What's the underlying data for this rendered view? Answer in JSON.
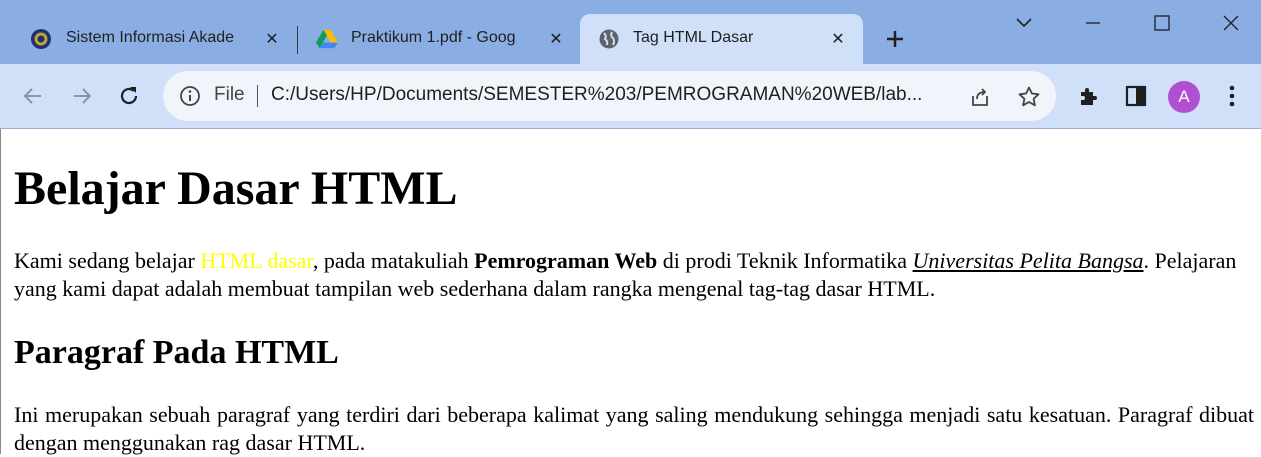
{
  "browser": {
    "tabs": [
      {
        "title": "Sistem Informasi Akade",
        "favicon": "university-logo-icon",
        "active": false
      },
      {
        "title": "Praktikum 1.pdf - Goog",
        "favicon": "google-drive-icon",
        "active": false
      },
      {
        "title": "Tag HTML Dasar",
        "favicon": "globe-icon",
        "active": true
      }
    ],
    "omnibox": {
      "scheme_label": "File",
      "url": "C:/Users/HP/Documents/SEMESTER%203/PEMROGRAMAN%20WEB/lab..."
    },
    "profile_initial": "A",
    "colors": {
      "tabstrip": "#8aaee3",
      "active_tab": "#cfe0f8",
      "avatar": "#b14fd1"
    }
  },
  "page": {
    "h1": "Belajar Dasar HTML",
    "p1": {
      "part1": "Kami sedang belajar ",
      "highlight": "HTML dasar",
      "part2": ", pada matakuliah ",
      "bold": "Pemrograman Web",
      "part3": " di prodi Teknik Informatika ",
      "italic_underline": "Universitas Pelita Bangsa",
      "part4": ". Pelajaran yang kami dapat adalah membuat tampilan web sederhana dalam rangka mengenal tag-tag dasar HTML."
    },
    "h2": "Paragraf Pada HTML",
    "p2": "Ini merupakan sebuah paragraf yang terdiri dari beberapa kalimat yang saling mendukung sehingga menjadi satu kesatuan. Paragraf dibuat dengan menggunakan rag dasar HTML.",
    "colors": {
      "highlight": "#ffff00"
    }
  }
}
